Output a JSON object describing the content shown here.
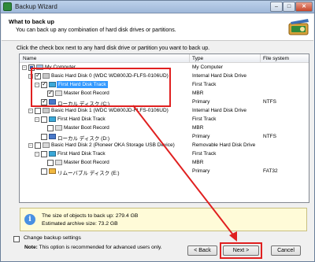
{
  "window": {
    "title": "Backup Wizard",
    "controls": {
      "minimize": "–",
      "maximize": "□",
      "close": "✕"
    }
  },
  "header": {
    "title": "What to back up",
    "subtitle": "You can back up any combination of hard disk drives or partitions."
  },
  "instruction": "Click the check box next to any hard disk drive or partition you want to back up.",
  "tree": {
    "columns": [
      "Name",
      "Type",
      "File system"
    ],
    "rows": [
      {
        "name": "My Computer",
        "type": "My Computer",
        "fs": ""
      },
      {
        "name": "Basic Hard Disk 0 (WDC WD800JD-FLFS-0106UD)",
        "type": "Internal Hard Disk Drive",
        "fs": ""
      },
      {
        "name": "First Hard Disk Track",
        "type": "First Track",
        "fs": ""
      },
      {
        "name": "Master Boot Record",
        "type": "MBR",
        "fs": ""
      },
      {
        "name": "ローカル ディスク (C:)",
        "type": "Primary",
        "fs": "NTFS"
      },
      {
        "name": "Basic Hard Disk 1 (WDC WD800JD-FLFS-0106UD)",
        "type": "Internal Hard Disk Drive",
        "fs": ""
      },
      {
        "name": "First Hard Disk Track",
        "type": "First Track",
        "fs": ""
      },
      {
        "name": "Master Boot Record",
        "type": "MBR",
        "fs": ""
      },
      {
        "name": "ローカル ディスク (D:)",
        "type": "Primary",
        "fs": "NTFS"
      },
      {
        "name": "Basic Hard Disk 2 (Pioneer OKA Storage USB Device)",
        "type": "Removable Hard Disk Drive",
        "fs": ""
      },
      {
        "name": "First Hard Disk Track",
        "type": "First Track",
        "fs": ""
      },
      {
        "name": "Master Boot Record",
        "type": "MBR",
        "fs": ""
      },
      {
        "name": "リムーバブル ディスク (E:)",
        "type": "Primary",
        "fs": "FAT32"
      }
    ]
  },
  "info": {
    "line1": "The size of objects to back up: 279.4 GB",
    "line2": "Estimated archive size: 73.2 GB"
  },
  "options": {
    "change_settings": "Change backup settings",
    "note_label": "Note:",
    "note_text": "This option is recommended for advanced users only."
  },
  "buttons": {
    "back": "< Back",
    "next": "Next >",
    "cancel": "Cancel"
  },
  "colors": {
    "annotation": "#e02020",
    "selection": "#3399ff"
  }
}
